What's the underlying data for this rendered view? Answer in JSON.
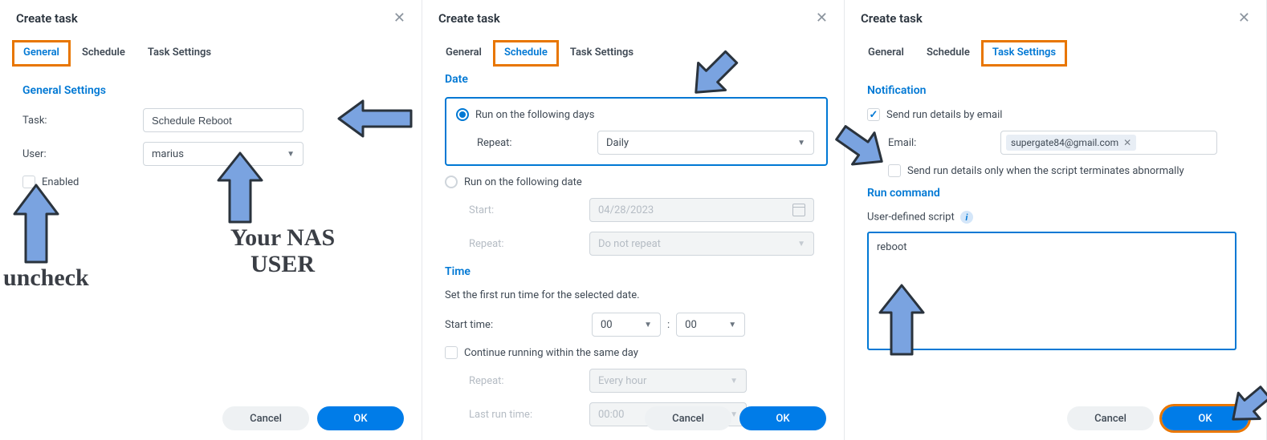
{
  "colors": {
    "accent": "#0078d4",
    "primary_btn": "#007ce8",
    "highlight": "#e87600",
    "arrow_fill": "#7aa3e0"
  },
  "pane1": {
    "title": "Create task",
    "tabs": {
      "general": "General",
      "schedule": "Schedule",
      "settings": "Task Settings"
    },
    "section": "General Settings",
    "task_label": "Task:",
    "task_value": "Schedule Reboot",
    "user_label": "User:",
    "user_value": "marius",
    "enabled_label": "Enabled",
    "cancel": "Cancel",
    "ok": "OK",
    "annotation_uncheck": "uncheck",
    "annotation_user": "Your NAS USER"
  },
  "pane2": {
    "title": "Create task",
    "tabs": {
      "general": "General",
      "schedule": "Schedule",
      "settings": "Task Settings"
    },
    "section_date": "Date",
    "radio_days": "Run on the following days",
    "repeat_label": "Repeat:",
    "repeat_value": "Daily",
    "radio_date": "Run on the following date",
    "start_label": "Start:",
    "start_value": "04/28/2023",
    "repeat2_label": "Repeat:",
    "repeat2_value": "Do not repeat",
    "section_time": "Time",
    "helper": "Set the first run time for the selected date.",
    "starttime_label": "Start time:",
    "hour": "00",
    "minute": "00",
    "continue_label": "Continue running within the same day",
    "repeat3_label": "Repeat:",
    "repeat3_value": "Every hour",
    "lastrun_label": "Last run time:",
    "lastrun_value": "00:00",
    "cancel": "Cancel",
    "ok": "OK"
  },
  "pane3": {
    "title": "Create task",
    "tabs": {
      "general": "General",
      "schedule": "Schedule",
      "settings": "Task Settings"
    },
    "section_notify": "Notification",
    "send_email_label": "Send run details by email",
    "email_label": "Email:",
    "email_value": "supergate84@gmail.com",
    "abnormal_label": "Send run details only when the script terminates abnormally",
    "section_run": "Run command",
    "script_label": "User-defined script",
    "script_value": "reboot",
    "cancel": "Cancel",
    "ok": "OK"
  }
}
